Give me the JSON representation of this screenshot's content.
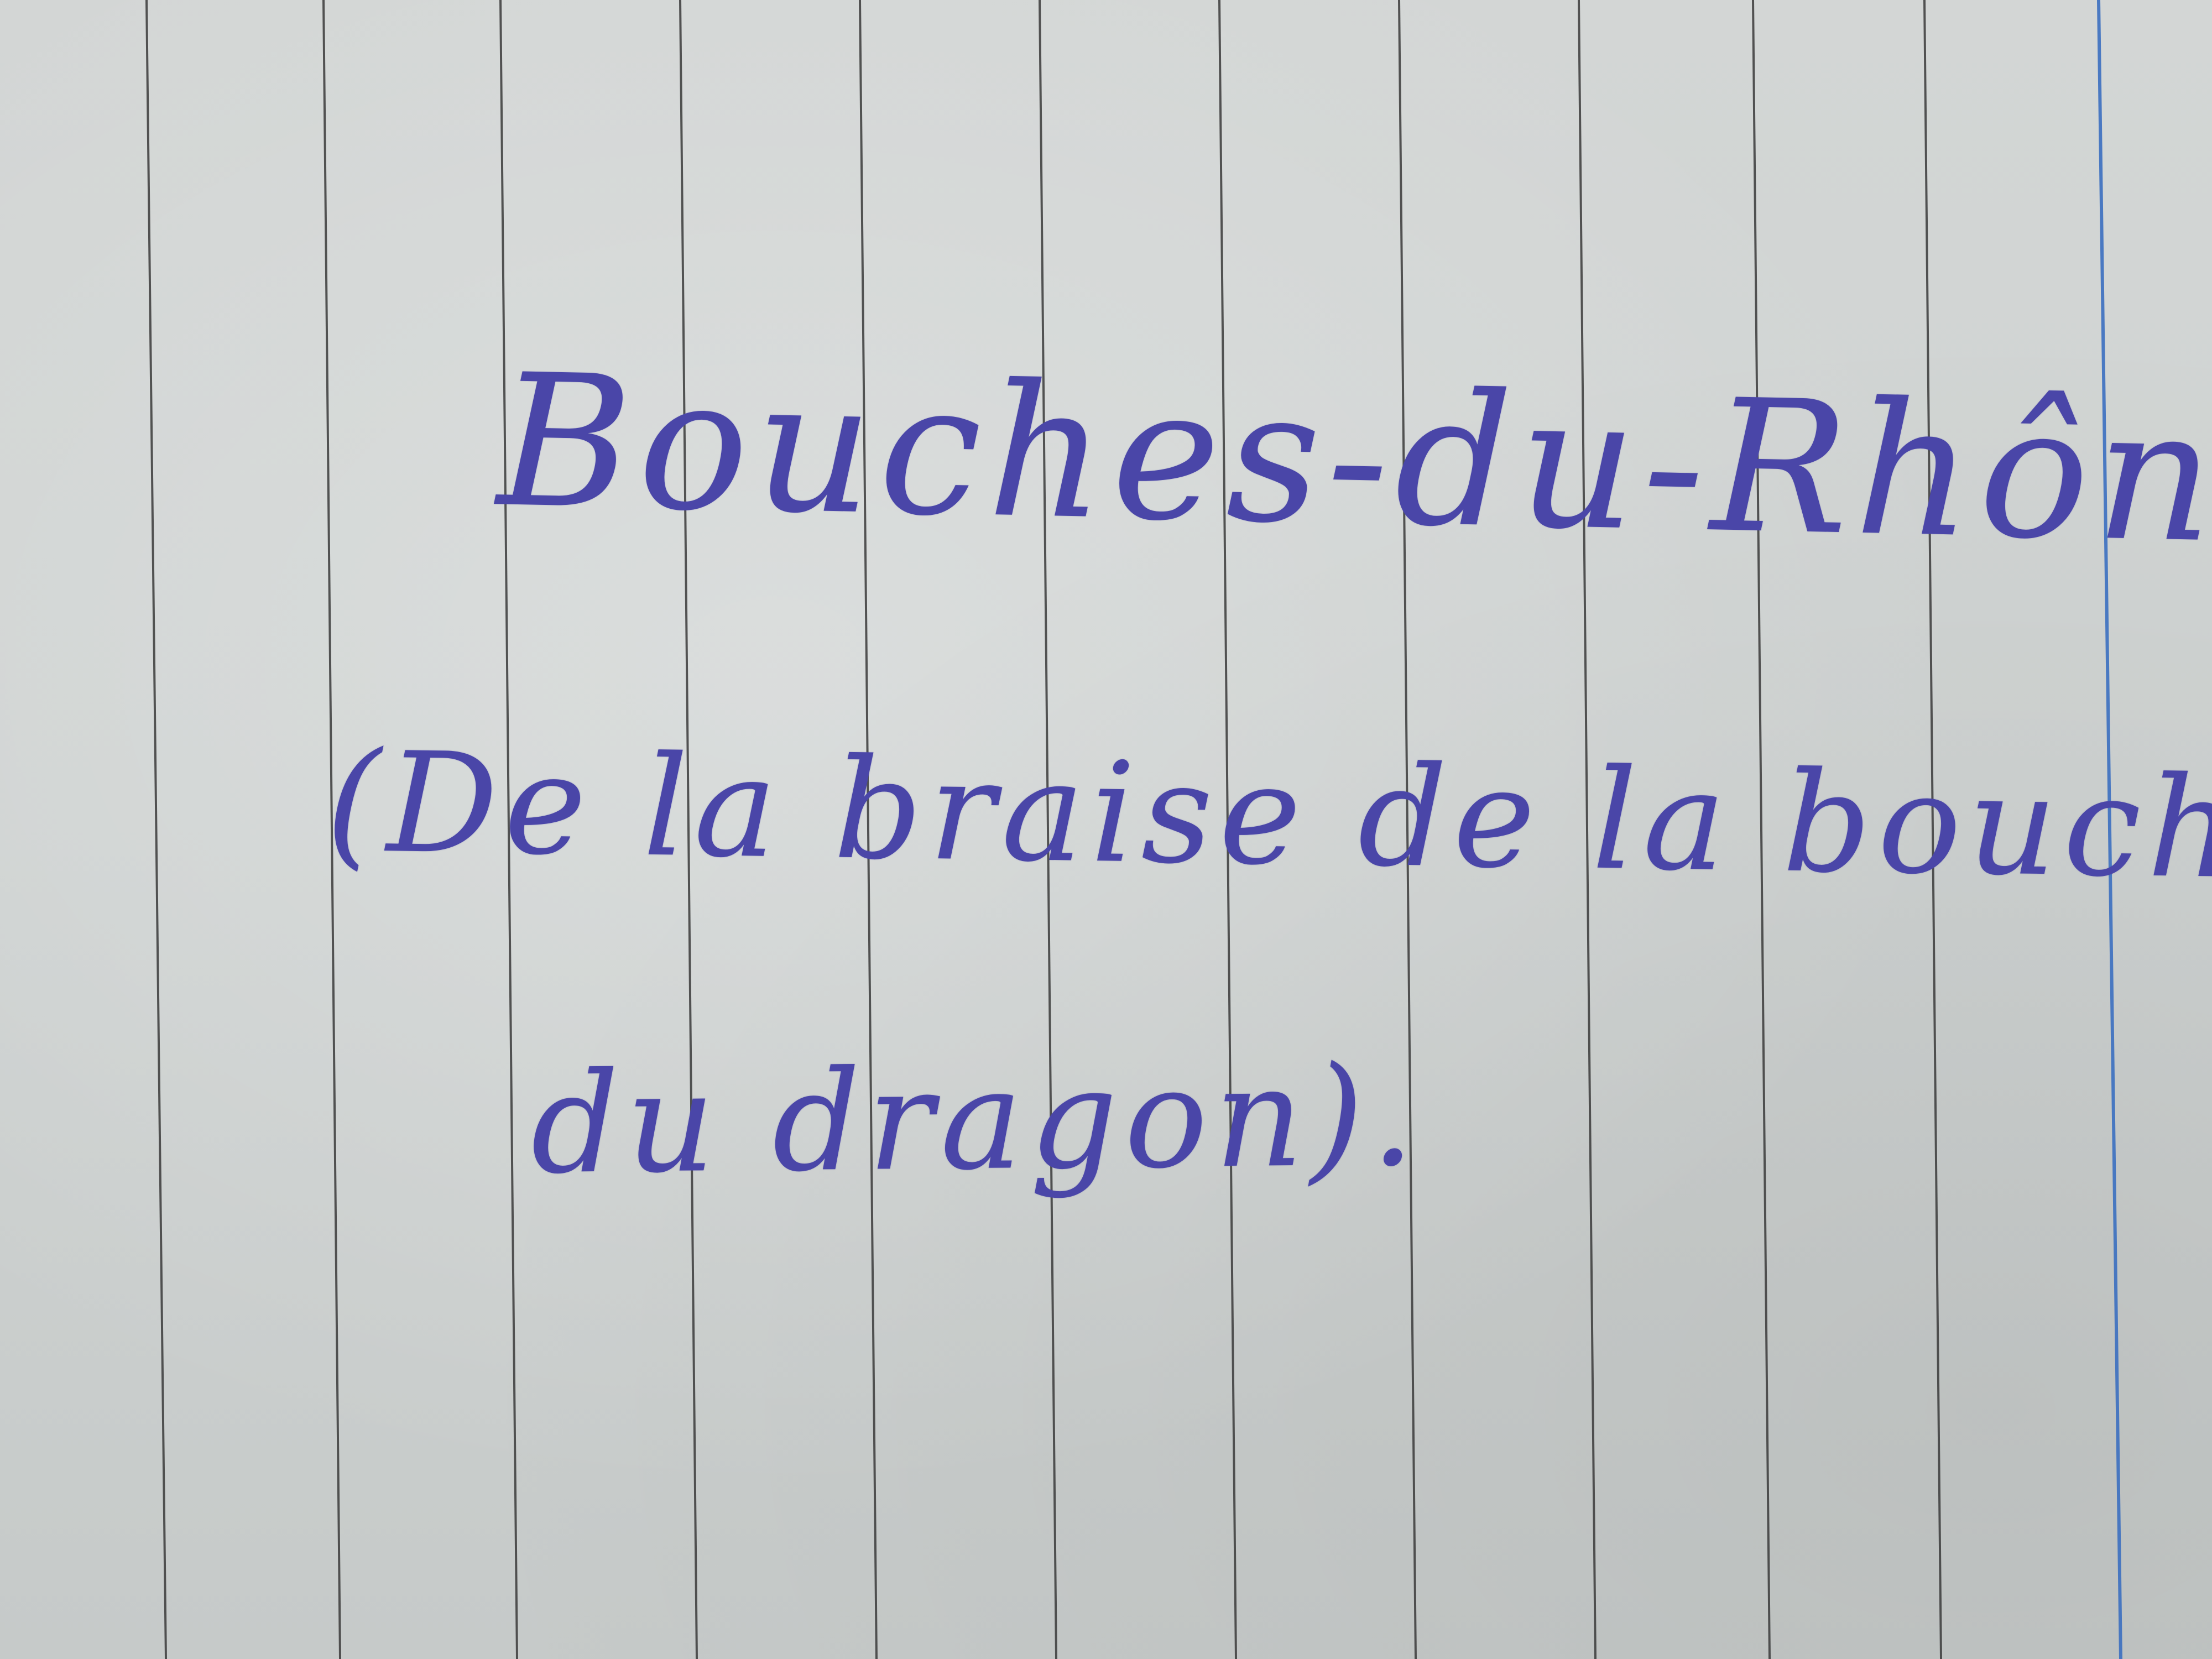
{
  "photo": {
    "subject": "lined-notebook-page",
    "paper_color": "#cfd3d2",
    "rule_color": "#3a3a3a",
    "margin_rule_color": "#3b6fc0",
    "ink_color": "#4a46a8"
  },
  "note": {
    "lines": [
      "Bouches-du-Rhône",
      "(De la braise de la bouche",
      "du dragon)."
    ]
  }
}
